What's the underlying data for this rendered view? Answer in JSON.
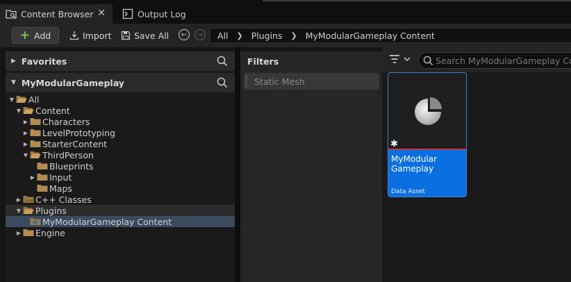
{
  "tabs": [
    {
      "label": "Content Browser",
      "icon": "content-browser-icon",
      "active": true
    },
    {
      "label": "Output Log",
      "icon": "output-log-icon",
      "active": false
    }
  ],
  "toolbar": {
    "add_label": "Add",
    "import_label": "Import",
    "save_all_label": "Save All"
  },
  "breadcrumb": [
    "All",
    "Plugins",
    "MyModularGameplay Content"
  ],
  "left_panel": {
    "favorites_label": "Favorites",
    "project_label": "MyModularGameplay"
  },
  "tree": [
    {
      "label": "All",
      "depth": 0,
      "expanded": true,
      "type": "folder-open"
    },
    {
      "label": "Content",
      "depth": 1,
      "expanded": true,
      "type": "folder-open"
    },
    {
      "label": "Characters",
      "depth": 2,
      "expanded": false,
      "type": "folder"
    },
    {
      "label": "LevelPrototyping",
      "depth": 2,
      "expanded": false,
      "type": "folder"
    },
    {
      "label": "StarterContent",
      "depth": 2,
      "expanded": false,
      "type": "folder"
    },
    {
      "label": "ThirdPerson",
      "depth": 2,
      "expanded": true,
      "type": "folder-open"
    },
    {
      "label": "Blueprints",
      "depth": 3,
      "expanded": null,
      "type": "folder"
    },
    {
      "label": "Input",
      "depth": 3,
      "expanded": false,
      "type": "folder"
    },
    {
      "label": "Maps",
      "depth": 3,
      "expanded": null,
      "type": "folder"
    },
    {
      "label": "C++ Classes",
      "depth": 1,
      "expanded": false,
      "type": "folder-cpp"
    },
    {
      "label": "Plugins",
      "depth": 1,
      "expanded": true,
      "type": "folder-open"
    },
    {
      "label": "MyModularGameplay Content",
      "depth": 2,
      "expanded": null,
      "type": "folder-plugin",
      "selected": true
    },
    {
      "label": "Engine",
      "depth": 1,
      "expanded": false,
      "type": "folder"
    }
  ],
  "filters": {
    "title": "Filters",
    "items": [
      "Static Mesh"
    ]
  },
  "search": {
    "placeholder": "Search MyModularGameplay Content"
  },
  "assets": [
    {
      "name": "MyModular Gameplay",
      "type": "Data Asset",
      "icon": "data-asset-pie-icon",
      "modified": true
    }
  ],
  "colors": {
    "accent_blue": "#0a6fe0",
    "asset_type_line": "#d0324a",
    "add_plus": "#7ec850",
    "selection": "#3b4b5f"
  }
}
